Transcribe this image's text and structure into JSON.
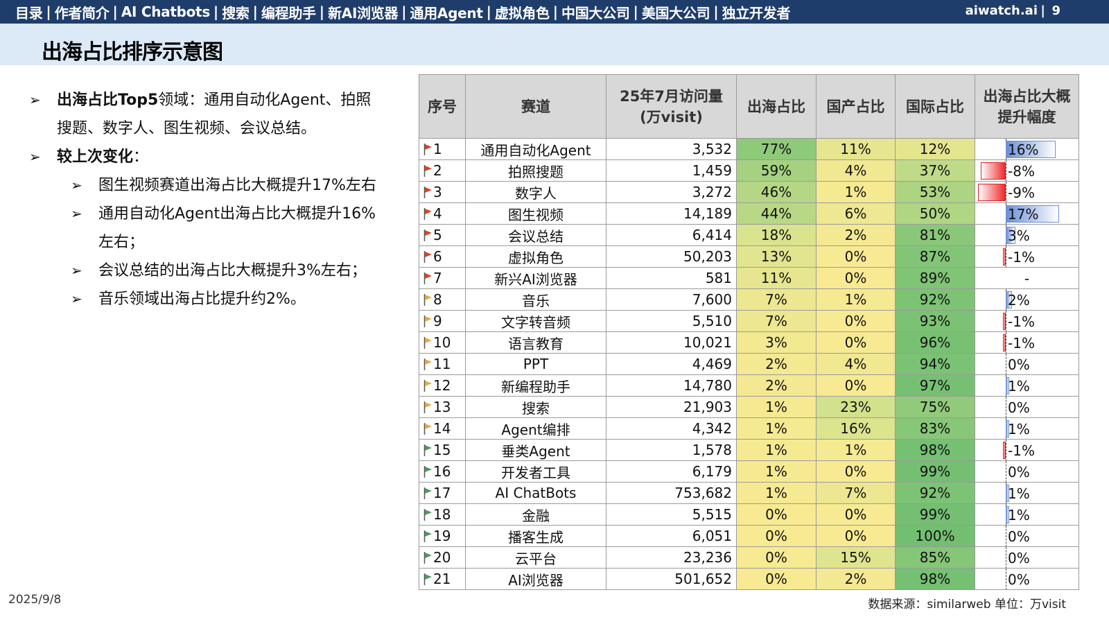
{
  "nav": {
    "items": [
      "目录",
      "作者简介",
      "AI Chatbots",
      "搜索",
      "编程助手",
      "新AI浏览器",
      "通用Agent",
      "虚拟角色",
      "中国大公司",
      "美国大公司",
      "独立开发者"
    ],
    "separator": "|",
    "brand": "aiwatch.ai",
    "page_sep": "|",
    "page_number": "9"
  },
  "title": "出海占比排序示意图",
  "bullets": [
    {
      "level": 1,
      "bold": "出海占比Top5",
      "text": "领域：通用自动化Agent、拍照搜题、数字人、图生视频、会议总结。"
    },
    {
      "level": 1,
      "bold": "较上次变化",
      "text": "："
    },
    {
      "level": 2,
      "bold": "",
      "text": "图生视频赛道出海占比大概提升17%左右"
    },
    {
      "level": 2,
      "bold": "",
      "text": "通用自动化Agent出海占比大概提升16%左右；"
    },
    {
      "level": 2,
      "bold": "",
      "text": "会议总结的出海占比大概提升3%左右；"
    },
    {
      "level": 2,
      "bold": "",
      "text": "音乐领域出海占比提升约2%。"
    }
  ],
  "bullet_icon": "arrow-bullet-icon",
  "table": {
    "headers": [
      "序号",
      "赛道",
      "25年7月访问量(万visit)",
      "出海占比",
      "国产占比",
      "国际占比",
      "出海占比大概提升幅度"
    ],
    "rows": [
      {
        "no": "1",
        "name": "通用自动化Agent",
        "visits": "3,532",
        "overseas": "77%",
        "domestic": "11%",
        "intl": "12%",
        "change": "16%",
        "change_value": 16,
        "flag": "red"
      },
      {
        "no": "2",
        "name": "拍照搜题",
        "visits": "1,459",
        "overseas": "59%",
        "domestic": "4%",
        "intl": "37%",
        "change": "-8%",
        "change_value": -8,
        "flag": "red"
      },
      {
        "no": "3",
        "name": "数字人",
        "visits": "3,272",
        "overseas": "46%",
        "domestic": "1%",
        "intl": "53%",
        "change": "-9%",
        "change_value": -9,
        "flag": "red"
      },
      {
        "no": "4",
        "name": "图生视频",
        "visits": "14,189",
        "overseas": "44%",
        "domestic": "6%",
        "intl": "50%",
        "change": "17%",
        "change_value": 17,
        "flag": "red"
      },
      {
        "no": "5",
        "name": "会议总结",
        "visits": "6,414",
        "overseas": "18%",
        "domestic": "2%",
        "intl": "81%",
        "change": "3%",
        "change_value": 3,
        "flag": "red"
      },
      {
        "no": "6",
        "name": "虚拟角色",
        "visits": "50,203",
        "overseas": "13%",
        "domestic": "0%",
        "intl": "87%",
        "change": "-1%",
        "change_value": -1,
        "flag": "red"
      },
      {
        "no": "7",
        "name": "新兴AI浏览器",
        "visits": "581",
        "overseas": "11%",
        "domestic": "0%",
        "intl": "89%",
        "change": "-",
        "change_value": null,
        "flag": "red"
      },
      {
        "no": "8",
        "name": "音乐",
        "visits": "7,600",
        "overseas": "7%",
        "domestic": "1%",
        "intl": "92%",
        "change": "2%",
        "change_value": 2,
        "flag": "orange"
      },
      {
        "no": "9",
        "name": "文字转音频",
        "visits": "5,510",
        "overseas": "7%",
        "domestic": "0%",
        "intl": "93%",
        "change": "-1%",
        "change_value": -1,
        "flag": "orange"
      },
      {
        "no": "10",
        "name": "语言教育",
        "visits": "10,021",
        "overseas": "3%",
        "domestic": "0%",
        "intl": "96%",
        "change": "-1%",
        "change_value": -1,
        "flag": "orange"
      },
      {
        "no": "11",
        "name": "PPT",
        "visits": "4,469",
        "overseas": "2%",
        "domestic": "4%",
        "intl": "94%",
        "change": "0%",
        "change_value": 0,
        "flag": "orange"
      },
      {
        "no": "12",
        "name": "新编程助手",
        "visits": "14,780",
        "overseas": "2%",
        "domestic": "0%",
        "intl": "97%",
        "change": "1%",
        "change_value": 1,
        "flag": "orange"
      },
      {
        "no": "13",
        "name": "搜索",
        "visits": "21,903",
        "overseas": "1%",
        "domestic": "23%",
        "intl": "75%",
        "change": "0%",
        "change_value": 0,
        "flag": "orange"
      },
      {
        "no": "14",
        "name": "Agent编排",
        "visits": "4,342",
        "overseas": "1%",
        "domestic": "16%",
        "intl": "83%",
        "change": "1%",
        "change_value": 1,
        "flag": "orange"
      },
      {
        "no": "15",
        "name": "垂类Agent",
        "visits": "1,578",
        "overseas": "1%",
        "domestic": "1%",
        "intl": "98%",
        "change": "-1%",
        "change_value": -1,
        "flag": "green"
      },
      {
        "no": "16",
        "name": "开发者工具",
        "visits": "6,179",
        "overseas": "1%",
        "domestic": "0%",
        "intl": "99%",
        "change": "0%",
        "change_value": 0,
        "flag": "green"
      },
      {
        "no": "17",
        "name": "AI ChatBots",
        "visits": "753,682",
        "overseas": "1%",
        "domestic": "7%",
        "intl": "92%",
        "change": "1%",
        "change_value": 1,
        "flag": "green"
      },
      {
        "no": "18",
        "name": "金融",
        "visits": "5,515",
        "overseas": "0%",
        "domestic": "0%",
        "intl": "99%",
        "change": "1%",
        "change_value": 1,
        "flag": "green"
      },
      {
        "no": "19",
        "name": "播客生成",
        "visits": "6,051",
        "overseas": "0%",
        "domestic": "0%",
        "intl": "100%",
        "change": "0%",
        "change_value": 0,
        "flag": "green"
      },
      {
        "no": "20",
        "name": "云平台",
        "visits": "23,236",
        "overseas": "0%",
        "domestic": "15%",
        "intl": "85%",
        "change": "0%",
        "change_value": 0,
        "flag": "green"
      },
      {
        "no": "21",
        "name": "AI浏览器",
        "visits": "501,652",
        "overseas": "0%",
        "domestic": "2%",
        "intl": "98%",
        "change": "0%",
        "change_value": 0,
        "flag": "green"
      }
    ],
    "flag_colors": {
      "red": "#e0401a",
      "orange": "#e8a83a",
      "green": "#4a9a5a"
    },
    "heat_colors": {
      "low": "#f7ea92",
      "mid": "#cfe08c",
      "high": "#73bf72"
    },
    "bar_colors": {
      "positive": "#6b8fd6",
      "negative": "#f02a2a"
    }
  },
  "footer": {
    "date": "2025/9/8",
    "source": "数据来源：similarweb  单位：万visit"
  }
}
